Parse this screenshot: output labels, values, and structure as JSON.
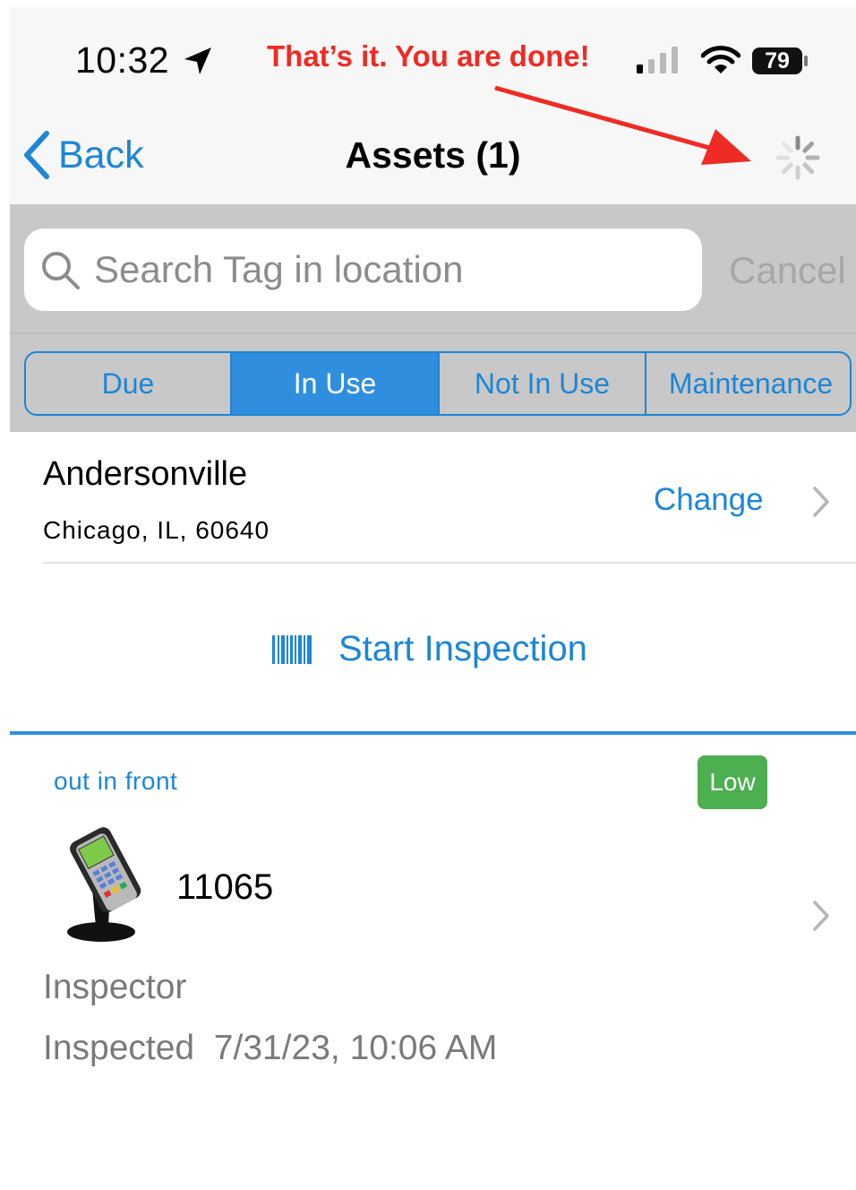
{
  "status_bar": {
    "time": "10:32",
    "battery": "79",
    "icons": [
      "location-arrow-icon",
      "signal-icon",
      "wifi-icon",
      "battery-icon"
    ]
  },
  "annotation": {
    "text": "That’s it. You are done!",
    "color": "#ee2b24"
  },
  "nav": {
    "back_label": "Back",
    "title": "Assets (1)",
    "right_icon": "loading-spinner-icon"
  },
  "search": {
    "placeholder": "Search Tag in location",
    "cancel_label": "Cancel"
  },
  "tabs": [
    {
      "label": "Due",
      "active": false
    },
    {
      "label": "In Use",
      "active": true
    },
    {
      "label": "Not In Use",
      "active": false
    },
    {
      "label": "Maintenance",
      "active": false
    }
  ],
  "location": {
    "name": "Andersonville",
    "address": "Chicago, IL, 60640",
    "change_label": "Change"
  },
  "start_inspection": {
    "label": "Start Inspection",
    "icon": "barcode-icon"
  },
  "asset": {
    "location_note": "out in front",
    "badge": "Low",
    "id": "11065",
    "role": "Inspector",
    "inspected_label": "Inspected",
    "inspected_date": "7/31/23, 10:06 AM",
    "icon": "card-terminal-icon"
  },
  "colors": {
    "accent": "#1d86d6",
    "active_tab": "#2f8fde",
    "badge": "#4caf50",
    "annotation": "#ee2b24"
  }
}
